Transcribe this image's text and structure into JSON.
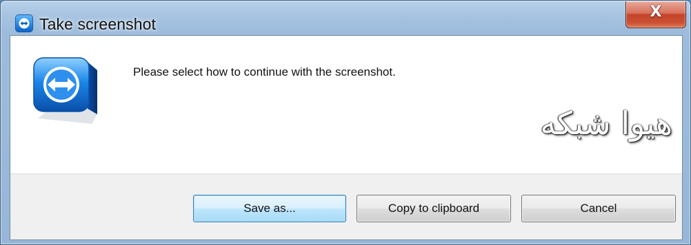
{
  "window": {
    "title": "Take screenshot",
    "close_label": "X"
  },
  "dialog": {
    "message": "Please select how to continue with the screenshot.",
    "watermark": "هیوا شبکه"
  },
  "buttons": {
    "save_label": "Save as...",
    "copy_label": "Copy to clipboard",
    "cancel_label": "Cancel"
  },
  "colors": {
    "title_gradient_top": "#b9d1ea",
    "close_red": "#c6452c",
    "default_button": "#3c7fb1",
    "logo_blue": "#0b6fd6"
  },
  "icons": {
    "title": "teamviewer-icon",
    "logo": "teamviewer-logo-icon",
    "close": "close-icon"
  }
}
